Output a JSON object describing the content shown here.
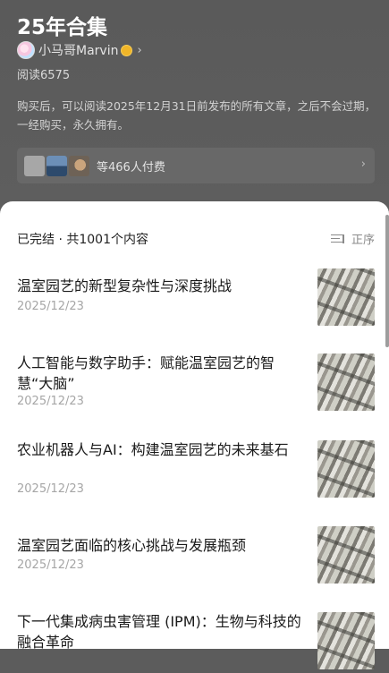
{
  "header": {
    "title": "25年合集",
    "author": "小马哥Marvin",
    "reads": "阅读6575",
    "description": "购买后，可以阅读2025年12月31日前发布的所有文章，之后不会过期，一经购买，永久拥有。",
    "paid_count": "等466人付费"
  },
  "list": {
    "status": "已完结 · 共1001个内容",
    "sort_label": "正序",
    "items": [
      {
        "title": "温室园艺的新型复杂性与深度挑战",
        "date": "2025/12/23"
      },
      {
        "title": "人工智能与数字助手：赋能温室园艺的智慧“大脑”",
        "date": "2025/12/23"
      },
      {
        "title": "农业机器人与AI：构建温室园艺的未来基石",
        "date": "2025/12/23"
      },
      {
        "title": "温室园艺面临的核心挑战与发展瓶颈",
        "date": "2025/12/23"
      },
      {
        "title": "下一代集成病虫害管理 (IPM)：生物与科技的融合革命",
        "date": ""
      }
    ]
  },
  "colors": {
    "header_bg": "#5c5c5c",
    "verified": "#f0b528",
    "date": "#a6a6a6"
  },
  "icons": {
    "verified": "verified-badge-icon",
    "chevron": "chevron-right-icon",
    "sort": "sort-order-icon"
  }
}
